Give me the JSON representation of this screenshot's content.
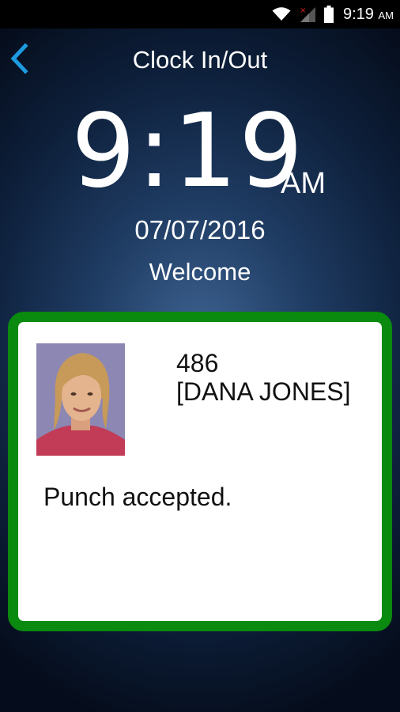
{
  "status_bar": {
    "time": "9:19",
    "ampm": "AM",
    "icons": [
      "wifi-icon",
      "signal-icon",
      "battery-icon"
    ]
  },
  "header": {
    "title": "Clock In/Out",
    "back_icon": "chevron-left-icon"
  },
  "clock": {
    "time": "9:19",
    "ampm": "AM",
    "date": "07/07/2016",
    "greeting": "Welcome"
  },
  "card": {
    "employee_id": "486",
    "employee_name": "[DANA JONES]",
    "message": "Punch accepted.",
    "border_color": "#0a8a0f"
  },
  "colors": {
    "accent_blue": "#1e9be0",
    "status_bar_bg": "#000000"
  }
}
